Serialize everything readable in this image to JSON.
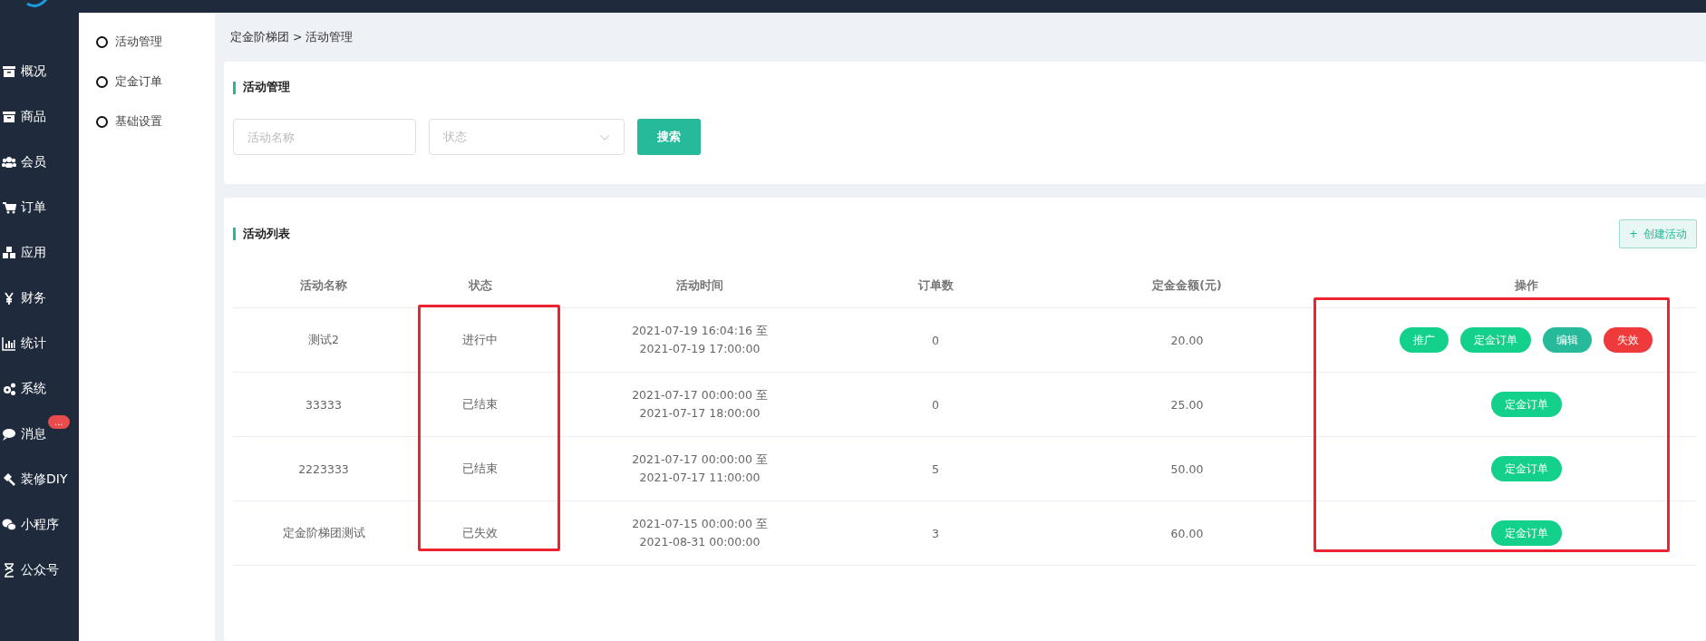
{
  "sidebar": {
    "items": [
      {
        "label": "概况"
      },
      {
        "label": "商品"
      },
      {
        "label": "会员"
      },
      {
        "label": "订单"
      },
      {
        "label": "应用"
      },
      {
        "label": "财务"
      },
      {
        "label": "统计"
      },
      {
        "label": "系统"
      },
      {
        "label": "消息",
        "badge": "..."
      },
      {
        "label": "装修DIY"
      },
      {
        "label": "小程序"
      },
      {
        "label": "公众号"
      }
    ]
  },
  "submenu": {
    "items": [
      {
        "label": "活动管理"
      },
      {
        "label": "定金订单"
      },
      {
        "label": "基础设置"
      }
    ]
  },
  "breadcrumb": "定金阶梯团 > 活动管理",
  "filter_card": {
    "title": "活动管理",
    "name_field": {
      "placeholder": "活动名称"
    },
    "status_select": {
      "placeholder": "状态"
    },
    "search_button": "搜索"
  },
  "list_card": {
    "title": "活动列表",
    "create_button": {
      "icon": "+",
      "label": "创建活动"
    },
    "table": {
      "columns": [
        {
          "label": "活动名称",
          "highlighted": false
        },
        {
          "label": "状态",
          "highlighted": true
        },
        {
          "label": "活动时间",
          "highlighted": false
        },
        {
          "label": "订单数",
          "highlighted": false
        },
        {
          "label": "定金金额(元)",
          "highlighted": false
        },
        {
          "label": "操作",
          "highlighted": true
        }
      ],
      "rows": [
        {
          "name": "测试2",
          "status": "进行中",
          "time": [
            "2021-07-19 16:04:16 至",
            "2021-07-19 17:00:00"
          ],
          "orders": "0",
          "amount": "20.00",
          "actions": [
            {
              "label": "推广",
              "kind": "primary"
            },
            {
              "label": "定金订单",
              "kind": "primary"
            },
            {
              "label": "编辑",
              "kind": "teal"
            },
            {
              "label": "失效",
              "kind": "danger"
            }
          ]
        },
        {
          "name": "33333",
          "status": "已结束",
          "time": [
            "2021-07-17 00:00:00 至",
            "2021-07-17 18:00:00"
          ],
          "orders": "0",
          "amount": "25.00",
          "actions": [
            {
              "label": "定金订单",
              "kind": "primary"
            }
          ]
        },
        {
          "name": "2223333",
          "status": "已结束",
          "time": [
            "2021-07-17 00:00:00 至",
            "2021-07-17 11:00:00"
          ],
          "orders": "5",
          "amount": "50.00",
          "actions": [
            {
              "label": "定金订单",
              "kind": "primary"
            }
          ]
        },
        {
          "name": "定金阶梯团测试",
          "status": "已失效",
          "time": [
            "2021-07-15 00:00:00 至",
            "2021-08-31 00:00:00"
          ],
          "orders": "3",
          "amount": "60.00",
          "actions": [
            {
              "label": "定金订单",
              "kind": "primary"
            }
          ]
        }
      ]
    }
  }
}
